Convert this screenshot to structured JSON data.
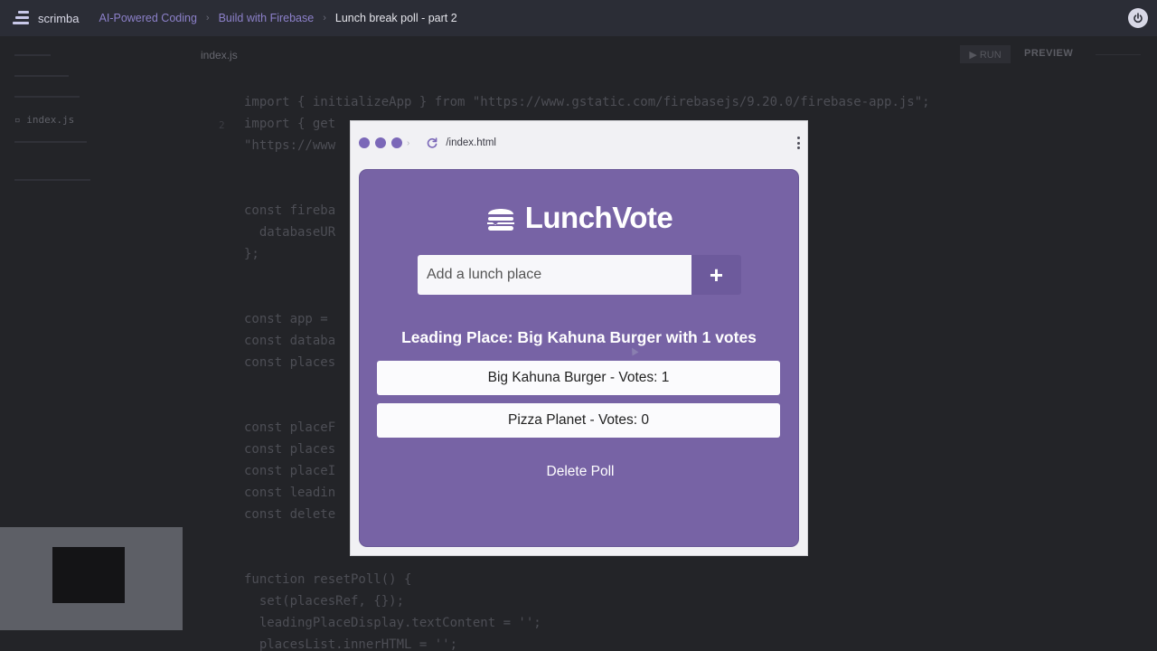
{
  "nav": {
    "logo_text": "scrimba",
    "breadcrumbs": [
      {
        "label": "AI-Powered Coding"
      },
      {
        "label": "Build with Firebase"
      },
      {
        "label": "Lunch break poll - part 2"
      }
    ],
    "separator": "›"
  },
  "editor": {
    "file_tab": "index.js",
    "sidebar_file": "index.js",
    "run_label": "▶ RUN",
    "preview_label": "PREVIEW",
    "code_lines": [
      {
        "text": "import { initializeApp } from \"https://www.gstatic.com/firebasejs/9.20.0/firebase-app.js\";"
      },
      {
        "text": "import { get"
      },
      {
        "text": "\"https://www"
      },
      {
        "text": "const fireba"
      },
      {
        "text": "  databaseUR"
      },
      {
        "text": "};"
      },
      {
        "text": "const app ="
      },
      {
        "text": "const databa"
      },
      {
        "text": "const places"
      },
      {
        "text": "const placeF"
      },
      {
        "text": "const places"
      },
      {
        "text": "const placeI"
      },
      {
        "text": "const leadin                                                          ');"
      },
      {
        "text": "const delete"
      },
      {
        "text": "function resetPoll() {"
      },
      {
        "text": "  set(placesRef, {});"
      },
      {
        "text": "  leadingPlaceDisplay.textContent = '';"
      },
      {
        "text": "  placesList.innerHTML = '';"
      }
    ],
    "line_number": "2"
  },
  "browser": {
    "url": "/index.html"
  },
  "app": {
    "title": "LunchVote",
    "input_placeholder": "Add a lunch place",
    "add_button_label": "+",
    "leading_text": "Leading Place: Big Kahuna Burger with 1 votes",
    "places": [
      {
        "label": "Big Kahuna Burger - Votes: 1"
      },
      {
        "label": "Pizza Planet - Votes: 0"
      }
    ],
    "delete_button_label": "Delete Poll"
  },
  "colors": {
    "app_bg": "#7763a5",
    "accent": "#7b68b8",
    "nav_link": "#8c80c9"
  }
}
